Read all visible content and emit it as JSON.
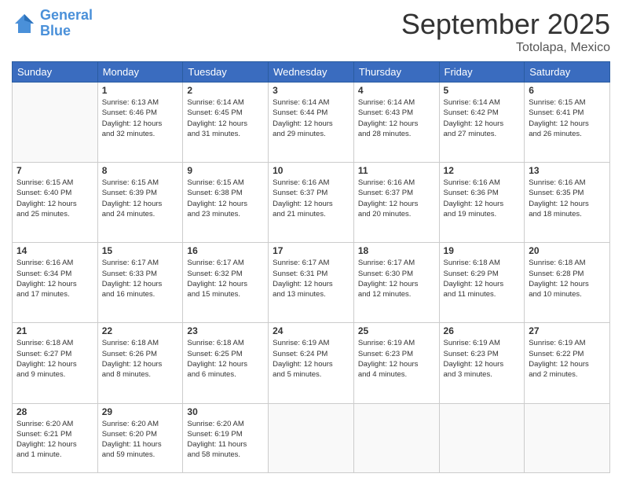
{
  "header": {
    "logo_line1": "General",
    "logo_line2": "Blue",
    "month": "September 2025",
    "location": "Totolapa, Mexico"
  },
  "days_of_week": [
    "Sunday",
    "Monday",
    "Tuesday",
    "Wednesday",
    "Thursday",
    "Friday",
    "Saturday"
  ],
  "weeks": [
    [
      {
        "day": "",
        "info": ""
      },
      {
        "day": "1",
        "info": "Sunrise: 6:13 AM\nSunset: 6:46 PM\nDaylight: 12 hours\nand 32 minutes."
      },
      {
        "day": "2",
        "info": "Sunrise: 6:14 AM\nSunset: 6:45 PM\nDaylight: 12 hours\nand 31 minutes."
      },
      {
        "day": "3",
        "info": "Sunrise: 6:14 AM\nSunset: 6:44 PM\nDaylight: 12 hours\nand 29 minutes."
      },
      {
        "day": "4",
        "info": "Sunrise: 6:14 AM\nSunset: 6:43 PM\nDaylight: 12 hours\nand 28 minutes."
      },
      {
        "day": "5",
        "info": "Sunrise: 6:14 AM\nSunset: 6:42 PM\nDaylight: 12 hours\nand 27 minutes."
      },
      {
        "day": "6",
        "info": "Sunrise: 6:15 AM\nSunset: 6:41 PM\nDaylight: 12 hours\nand 26 minutes."
      }
    ],
    [
      {
        "day": "7",
        "info": "Sunrise: 6:15 AM\nSunset: 6:40 PM\nDaylight: 12 hours\nand 25 minutes."
      },
      {
        "day": "8",
        "info": "Sunrise: 6:15 AM\nSunset: 6:39 PM\nDaylight: 12 hours\nand 24 minutes."
      },
      {
        "day": "9",
        "info": "Sunrise: 6:15 AM\nSunset: 6:38 PM\nDaylight: 12 hours\nand 23 minutes."
      },
      {
        "day": "10",
        "info": "Sunrise: 6:16 AM\nSunset: 6:37 PM\nDaylight: 12 hours\nand 21 minutes."
      },
      {
        "day": "11",
        "info": "Sunrise: 6:16 AM\nSunset: 6:37 PM\nDaylight: 12 hours\nand 20 minutes."
      },
      {
        "day": "12",
        "info": "Sunrise: 6:16 AM\nSunset: 6:36 PM\nDaylight: 12 hours\nand 19 minutes."
      },
      {
        "day": "13",
        "info": "Sunrise: 6:16 AM\nSunset: 6:35 PM\nDaylight: 12 hours\nand 18 minutes."
      }
    ],
    [
      {
        "day": "14",
        "info": "Sunrise: 6:16 AM\nSunset: 6:34 PM\nDaylight: 12 hours\nand 17 minutes."
      },
      {
        "day": "15",
        "info": "Sunrise: 6:17 AM\nSunset: 6:33 PM\nDaylight: 12 hours\nand 16 minutes."
      },
      {
        "day": "16",
        "info": "Sunrise: 6:17 AM\nSunset: 6:32 PM\nDaylight: 12 hours\nand 15 minutes."
      },
      {
        "day": "17",
        "info": "Sunrise: 6:17 AM\nSunset: 6:31 PM\nDaylight: 12 hours\nand 13 minutes."
      },
      {
        "day": "18",
        "info": "Sunrise: 6:17 AM\nSunset: 6:30 PM\nDaylight: 12 hours\nand 12 minutes."
      },
      {
        "day": "19",
        "info": "Sunrise: 6:18 AM\nSunset: 6:29 PM\nDaylight: 12 hours\nand 11 minutes."
      },
      {
        "day": "20",
        "info": "Sunrise: 6:18 AM\nSunset: 6:28 PM\nDaylight: 12 hours\nand 10 minutes."
      }
    ],
    [
      {
        "day": "21",
        "info": "Sunrise: 6:18 AM\nSunset: 6:27 PM\nDaylight: 12 hours\nand 9 minutes."
      },
      {
        "day": "22",
        "info": "Sunrise: 6:18 AM\nSunset: 6:26 PM\nDaylight: 12 hours\nand 8 minutes."
      },
      {
        "day": "23",
        "info": "Sunrise: 6:18 AM\nSunset: 6:25 PM\nDaylight: 12 hours\nand 6 minutes."
      },
      {
        "day": "24",
        "info": "Sunrise: 6:19 AM\nSunset: 6:24 PM\nDaylight: 12 hours\nand 5 minutes."
      },
      {
        "day": "25",
        "info": "Sunrise: 6:19 AM\nSunset: 6:23 PM\nDaylight: 12 hours\nand 4 minutes."
      },
      {
        "day": "26",
        "info": "Sunrise: 6:19 AM\nSunset: 6:23 PM\nDaylight: 12 hours\nand 3 minutes."
      },
      {
        "day": "27",
        "info": "Sunrise: 6:19 AM\nSunset: 6:22 PM\nDaylight: 12 hours\nand 2 minutes."
      }
    ],
    [
      {
        "day": "28",
        "info": "Sunrise: 6:20 AM\nSunset: 6:21 PM\nDaylight: 12 hours\nand 1 minute."
      },
      {
        "day": "29",
        "info": "Sunrise: 6:20 AM\nSunset: 6:20 PM\nDaylight: 11 hours\nand 59 minutes."
      },
      {
        "day": "30",
        "info": "Sunrise: 6:20 AM\nSunset: 6:19 PM\nDaylight: 11 hours\nand 58 minutes."
      },
      {
        "day": "",
        "info": ""
      },
      {
        "day": "",
        "info": ""
      },
      {
        "day": "",
        "info": ""
      },
      {
        "day": "",
        "info": ""
      }
    ]
  ]
}
